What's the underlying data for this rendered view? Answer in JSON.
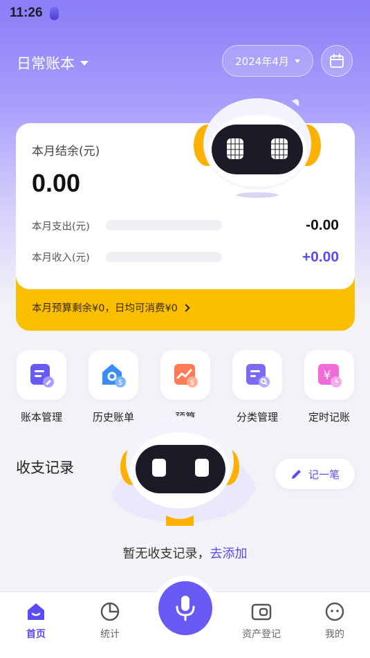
{
  "status_bar": {
    "time": "11:26"
  },
  "header": {
    "book_name": "日常账本",
    "month": "2024年4月"
  },
  "summary": {
    "balance_label": "本月结余(元)",
    "balance_value": "0.00",
    "expense_label": "本月支出(元)",
    "expense_value": "-0.00",
    "income_label": "本月收入(元)",
    "income_value": "+0.00",
    "budget_text": "本月预算剩余¥0，日均可消费¥0"
  },
  "actions": [
    {
      "label": "账本管理",
      "icon": "ledger-edit-icon",
      "color": "#6a5af5"
    },
    {
      "label": "历史账单",
      "icon": "history-bill-icon",
      "color": "#3b8cf5"
    },
    {
      "label": "预算",
      "icon": "budget-chart-icon",
      "color": "#ff7a55"
    },
    {
      "label": "分类管理",
      "icon": "category-search-icon",
      "color": "#7a6af5"
    },
    {
      "label": "定时记账",
      "icon": "timed-yuan-icon",
      "color": "#f06ad8"
    }
  ],
  "records": {
    "title": "收支记录",
    "add_label": "记一笔",
    "empty_text": "暂无收支记录，",
    "empty_link": "去添加"
  },
  "tabbar": {
    "home": "首页",
    "stats": "统计",
    "assets": "资产登记",
    "mine": "我的"
  },
  "colors": {
    "accent": "#6a5af5",
    "expense": "#111111",
    "income": "#5a4cf0",
    "budget_bg": "#fcbf00"
  }
}
